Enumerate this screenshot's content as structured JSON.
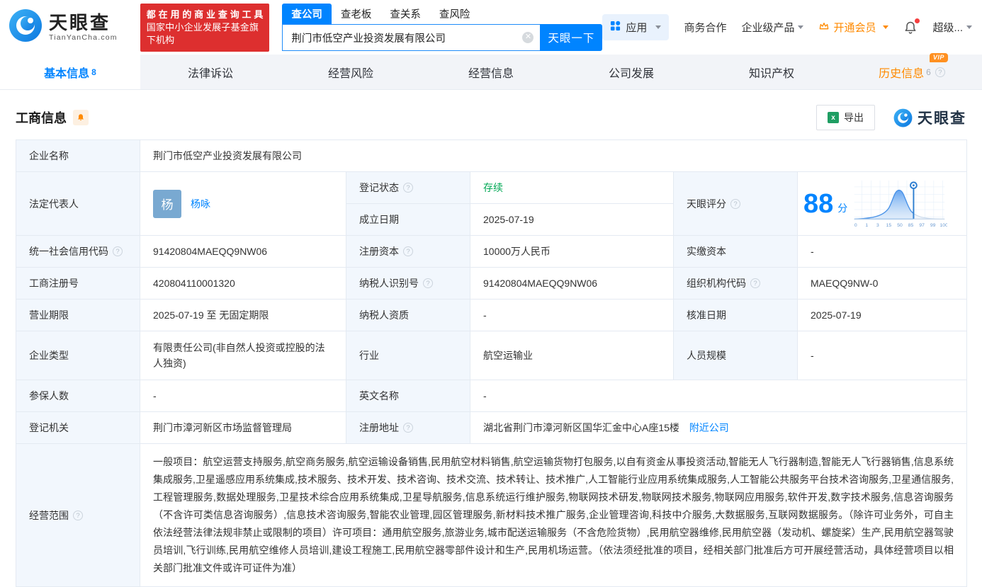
{
  "header": {
    "brand": "天眼查",
    "brand_domain": "TianYanCha.com",
    "promo_line1": "都在用的商业查询工具",
    "promo_line2": "国家中小企业发展子基金旗下机构",
    "search_tabs": [
      {
        "label": "查公司"
      },
      {
        "label": "查老板"
      },
      {
        "label": "查关系"
      },
      {
        "label": "查风险"
      }
    ],
    "search_value": "荆门市低空产业投资发展有限公司",
    "search_button": "天眼一下",
    "nav_apps": "应用",
    "nav_cooperation": "商务合作",
    "nav_enterprise": "企业级产品",
    "nav_vip": "开通会员",
    "nav_user": "超级..."
  },
  "tabs": [
    {
      "label": "基本信息",
      "count": "8"
    },
    {
      "label": "法律诉讼",
      "count": ""
    },
    {
      "label": "经营风险",
      "count": ""
    },
    {
      "label": "经营信息",
      "count": ""
    },
    {
      "label": "公司发展",
      "count": ""
    },
    {
      "label": "知识产权",
      "count": ""
    },
    {
      "label": "历史信息",
      "count": "6",
      "badge": "VIP"
    }
  ],
  "section": {
    "title": "工商信息",
    "export_label": "导出",
    "brand": "天眼查"
  },
  "fields": {
    "company_name": {
      "label": "企业名称",
      "value": "荆门市低空产业投资发展有限公司"
    },
    "legal_rep": {
      "label": "法定代表人",
      "avatar_char": "杨",
      "name": "杨咏"
    },
    "reg_status": {
      "label": "登记状态",
      "value": "存续"
    },
    "establish_date": {
      "label": "成立日期",
      "value": "2025-07-19"
    },
    "score": {
      "label": "天眼评分",
      "value": "88",
      "unit": "分",
      "ticks": [
        "0",
        "1",
        "3",
        "15",
        "50",
        "85",
        "97",
        "99",
        "100"
      ]
    },
    "credit_code": {
      "label": "统一社会信用代码",
      "value": "91420804MAEQQ9NW06"
    },
    "reg_capital": {
      "label": "注册资本",
      "value": "10000万人民币"
    },
    "paid_capital": {
      "label": "实缴资本",
      "value": "-"
    },
    "reg_no": {
      "label": "工商注册号",
      "value": "420804110001320"
    },
    "taxpayer_no": {
      "label": "纳税人识别号",
      "value": "91420804MAEQQ9NW06"
    },
    "org_code": {
      "label": "组织机构代码",
      "value": "MAEQQ9NW-0"
    },
    "term": {
      "label": "营业期限",
      "value": "2025-07-19 至 无固定期限"
    },
    "taxpayer_quality": {
      "label": "纳税人资质",
      "value": "-"
    },
    "approve_date": {
      "label": "核准日期",
      "value": "2025-07-19"
    },
    "company_type": {
      "label": "企业类型",
      "value": "有限责任公司(非自然人投资或控股的法人独资)"
    },
    "industry": {
      "label": "行业",
      "value": "航空运输业"
    },
    "staff_size": {
      "label": "人员规模",
      "value": "-"
    },
    "insured_num": {
      "label": "参保人数",
      "value": "-"
    },
    "english_name": {
      "label": "英文名称",
      "value": "-"
    },
    "reg_org": {
      "label": "登记机关",
      "value": "荆门市漳河新区市场监督管理局"
    },
    "address": {
      "label": "注册地址",
      "value": "湖北省荆门市漳河新区国华汇金中心A座15楼",
      "nearby": "附近公司"
    },
    "scope": {
      "label": "经营范围",
      "value": "一般项目：航空运营支持服务,航空商务服务,航空运输设备销售,民用航空材料销售,航空运输货物打包服务,以自有资金从事投资活动,智能无人飞行器制造,智能无人飞行器销售,信息系统集成服务,卫星遥感应用系统集成,技术服务、技术开发、技术咨询、技术交流、技术转让、技术推广,人工智能行业应用系统集成服务,人工智能公共服务平台技术咨询服务,卫星通信服务,工程管理服务,数据处理服务,卫星技术综合应用系统集成,卫星导航服务,信息系统运行维护服务,物联网技术研发,物联网技术服务,物联网应用服务,软件开发,数字技术服务,信息咨询服务（不含许可类信息咨询服务）,信息技术咨询服务,智能农业管理,园区管理服务,新材料技术推广服务,企业管理咨询,科技中介服务,大数据服务,互联网数据服务。（除许可业务外，可自主依法经营法律法规非禁止或限制的项目）许可项目：通用航空服务,旅游业务,城市配送运输服务（不含危险货物）,民用航空器维修,民用航空器（发动机、螺旋桨）生产,民用航空器驾驶员培训,飞行训练,民用航空维修人员培训,建设工程施工,民用航空器零部件设计和生产,民用机场运营。（依法须经批准的项目，经相关部门批准后方可开展经营活动，具体经营项目以相关部门批准文件或许可证件为准）"
    }
  }
}
